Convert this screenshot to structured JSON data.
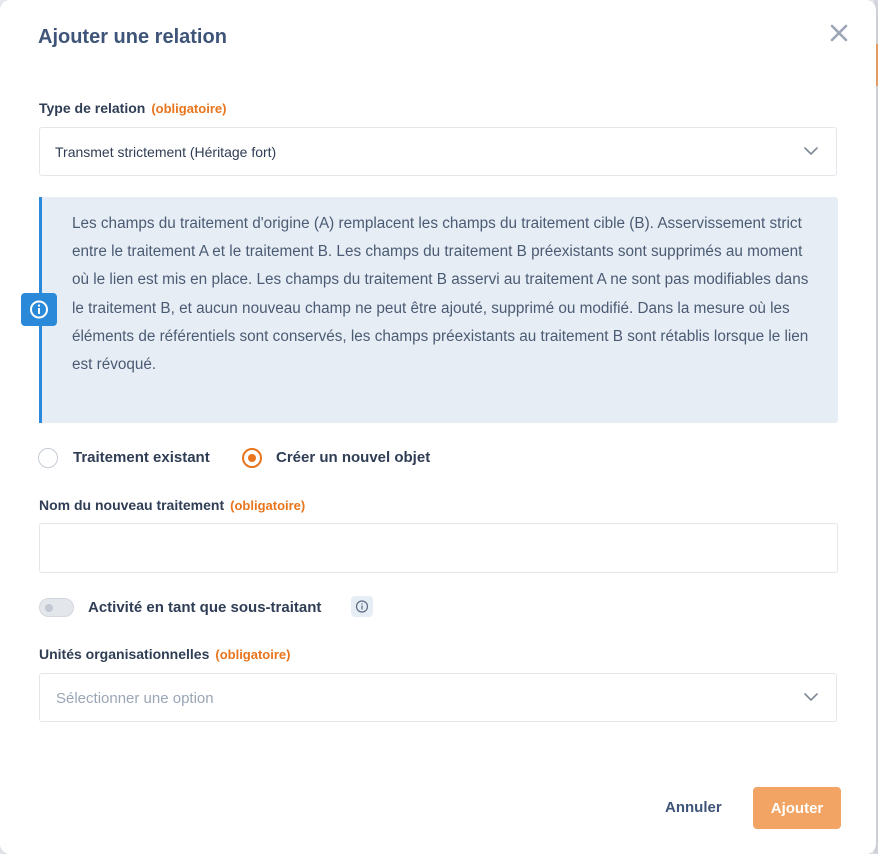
{
  "dialog": {
    "title": "Ajouter une relation",
    "close_icon": "close-icon"
  },
  "relation_type": {
    "label": "Type de relation",
    "required": "(obligatoire)",
    "value": "Transmet strictement (Héritage fort)",
    "icon": "chevron-down-icon"
  },
  "info": {
    "icon": "info-icon",
    "text": "Les champs du traitement d'origine (A) remplacent les champs du traitement cible (B). Asservissement strict entre le traitement A et le traitement B. Les champs du traitement B préexistants sont supprimés au moment où le lien est mis en place. Les champs du traitement B asservi au traitement A ne sont pas modifiables dans le traitement B, et aucun nouveau champ ne peut être ajouté, supprimé ou modifié. Dans la mesure où les éléments de référentiels sont conservés, les champs préexistants au traitement B sont rétablis lorsque le lien est révoqué.",
    "accent_color": "#2a8ad9",
    "background_color": "#e6edf5"
  },
  "options": {
    "existing_label": "Traitement existant",
    "new_label": "Créer un nouvel objet",
    "selected": "new"
  },
  "new_name": {
    "label": "Nom du nouveau traitement",
    "required": "(obligatoire)",
    "value": ""
  },
  "subcontractor": {
    "label": "Activité en tant que sous-traitant",
    "enabled": false,
    "icon": "info-icon"
  },
  "org_units": {
    "label": "Unités organisationnelles",
    "required": "(obligatoire)",
    "placeholder": "Sélectionner une option",
    "icon": "chevron-down-icon"
  },
  "footer": {
    "cancel_label": "Annuler",
    "add_label": "Ajouter"
  },
  "colors": {
    "accent": "#e8741c",
    "primary_button": "#f1a463",
    "title": "#3e5478"
  }
}
